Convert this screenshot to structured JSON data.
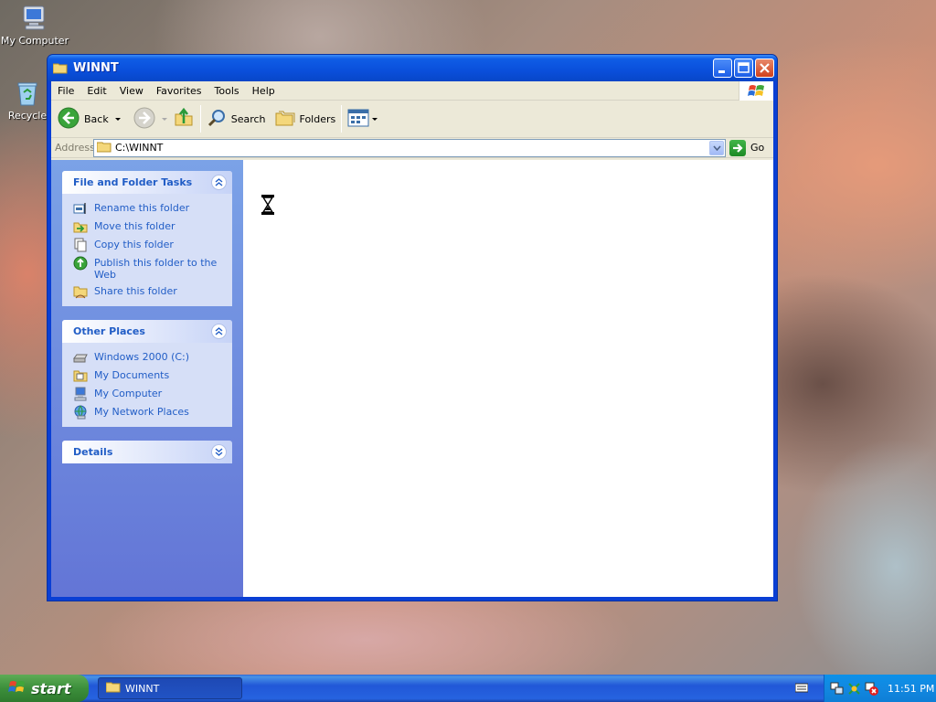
{
  "desktop": {
    "icons": [
      {
        "label": "My Computer",
        "icon": "my-computer-icon"
      },
      {
        "label": "Recycle",
        "icon": "recycle-bin-icon"
      }
    ]
  },
  "window": {
    "title": "WINNT",
    "menu": [
      "File",
      "Edit",
      "View",
      "Favorites",
      "Tools",
      "Help"
    ],
    "toolbar": {
      "back": "Back",
      "search": "Search",
      "folders": "Folders"
    },
    "address": {
      "label": "Address",
      "value": "C:\\WINNT",
      "go": "Go"
    },
    "tasks_panel": {
      "title": "File and Folder Tasks",
      "items": [
        "Rename this folder",
        "Move this folder",
        "Copy this folder",
        "Publish this folder to the Web",
        "Share this folder"
      ]
    },
    "places_panel": {
      "title": "Other Places",
      "items": [
        "Windows 2000 (C:)",
        "My Documents",
        "My Computer",
        "My Network Places"
      ]
    },
    "details_panel": {
      "title": "Details"
    }
  },
  "taskbar": {
    "start": "start",
    "task": "WINNT",
    "clock": "11:51 PM"
  },
  "colors": {
    "titlebar": "#0a4fdb",
    "taskpane_link": "#215dc6",
    "start_green": "#3c8f3b"
  }
}
